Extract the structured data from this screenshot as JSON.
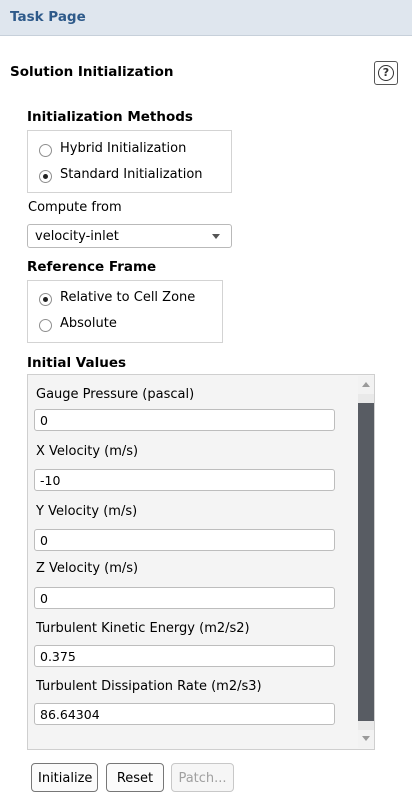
{
  "header": {
    "title": "Task Page"
  },
  "panel": {
    "title": "Solution Initialization",
    "help_symbol": "?"
  },
  "init_methods": {
    "title": "Initialization Methods",
    "options": [
      {
        "label": "Hybrid  Initialization",
        "selected": false
      },
      {
        "label": "Standard Initialization",
        "selected": true
      }
    ]
  },
  "compute_from": {
    "label": "Compute from",
    "value": "velocity-inlet"
  },
  "reference_frame": {
    "title": "Reference Frame",
    "options": [
      {
        "label": "Relative to Cell Zone",
        "selected": true
      },
      {
        "label": "Absolute",
        "selected": false
      }
    ]
  },
  "initial_values": {
    "title": "Initial Values",
    "fields": [
      {
        "label": "Gauge Pressure (pascal)",
        "value": "0"
      },
      {
        "label": "X Velocity (m/s)",
        "value": "-10"
      },
      {
        "label": "Y Velocity (m/s)",
        "value": "0"
      },
      {
        "label": "Z Velocity (m/s)",
        "value": "0"
      },
      {
        "label": "Turbulent Kinetic Energy (m2/s2)",
        "value": "0.375"
      },
      {
        "label": "Turbulent Dissipation Rate (m2/s3)",
        "value": "86.64304"
      }
    ]
  },
  "buttons": {
    "initialize": "Initialize",
    "reset": "Reset",
    "patch": "Patch..."
  },
  "icons": {
    "help": "help-icon",
    "dropdown": "chevron-down-icon"
  }
}
